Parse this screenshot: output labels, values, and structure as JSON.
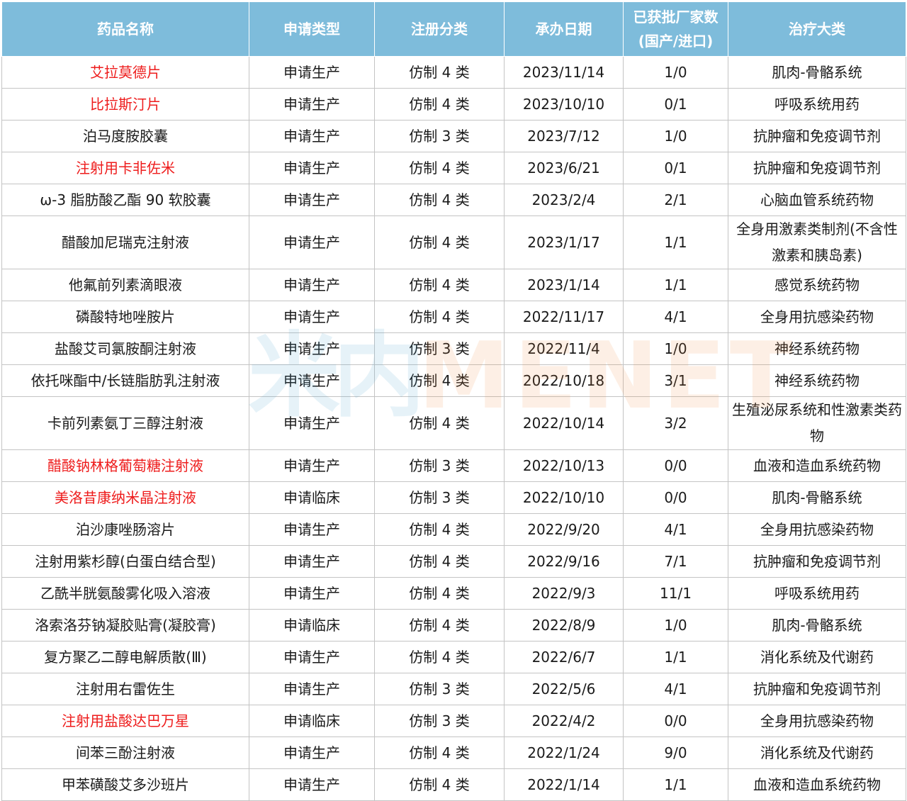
{
  "header": {
    "name": "药品名称",
    "apply_type": "申请类型",
    "reg_class": "注册分类",
    "date": "承办日期",
    "approved_line1": "已获批厂家数",
    "approved_line2": "(国产/进口)",
    "category": "治疗大类"
  },
  "rows": [
    {
      "name": "艾拉莫德片",
      "apply_type": "申请生产",
      "reg_class": "仿制 4 类",
      "date": "2023/11/14",
      "approved": "1/0",
      "category": "肌肉-骨骼系统"
    },
    {
      "name": "比拉斯汀片",
      "apply_type": "申请生产",
      "reg_class": "仿制 4 类",
      "date": "2023/10/10",
      "approved": "0/1",
      "category": "呼吸系统用药"
    },
    {
      "name": "泊马度胺胶囊",
      "apply_type": "申请生产",
      "reg_class": "仿制 3 类",
      "date": "2023/7/12",
      "approved": "1/0",
      "category": "抗肿瘤和免疫调节剂"
    },
    {
      "name": "注射用卡非佐米",
      "apply_type": "申请生产",
      "reg_class": "仿制 4 类",
      "date": "2023/6/21",
      "approved": "0/1",
      "category": "抗肿瘤和免疫调节剂"
    },
    {
      "name": "ω-3 脂肪酸乙酯 90 软胶囊",
      "apply_type": "申请生产",
      "reg_class": "仿制 4 类",
      "date": "2023/2/4",
      "approved": "2/1",
      "category": "心脑血管系统药物"
    },
    {
      "name": "醋酸加尼瑞克注射液",
      "apply_type": "申请生产",
      "reg_class": "仿制 4 类",
      "date": "2023/1/17",
      "approved": "1/1",
      "category": "全身用激素类制剂(不含性激素和胰岛素)"
    },
    {
      "name": "他氟前列素滴眼液",
      "apply_type": "申请生产",
      "reg_class": "仿制 4 类",
      "date": "2023/1/14",
      "approved": "1/1",
      "category": "感觉系统药物"
    },
    {
      "name": "磷酸特地唑胺片",
      "apply_type": "申请生产",
      "reg_class": "仿制 4 类",
      "date": "2022/11/17",
      "approved": "4/1",
      "category": "全身用抗感染药物"
    },
    {
      "name": "盐酸艾司氯胺酮注射液",
      "apply_type": "申请生产",
      "reg_class": "仿制 3 类",
      "date": "2022/11/4",
      "approved": "1/0",
      "category": "神经系统药物"
    },
    {
      "name": "依托咪酯中/长链脂肪乳注射液",
      "apply_type": "申请生产",
      "reg_class": "仿制 4 类",
      "date": "2022/10/18",
      "approved": "3/1",
      "category": "神经系统药物"
    },
    {
      "name": "卡前列素氨丁三醇注射液",
      "apply_type": "申请生产",
      "reg_class": "仿制 4 类",
      "date": "2022/10/14",
      "approved": "3/2",
      "category": "生殖泌尿系统和性激素类药物"
    },
    {
      "name": "醋酸钠林格葡萄糖注射液",
      "apply_type": "申请生产",
      "reg_class": "仿制 3 类",
      "date": "2022/10/13",
      "approved": "0/0",
      "category": "血液和造血系统药物"
    },
    {
      "name": "美洛昔康纳米晶注射液",
      "apply_type": "申请临床",
      "reg_class": "仿制 3 类",
      "date": "2022/10/10",
      "approved": "0/0",
      "category": "肌肉-骨骼系统"
    },
    {
      "name": "泊沙康唑肠溶片",
      "apply_type": "申请生产",
      "reg_class": "仿制 4 类",
      "date": "2022/9/20",
      "approved": "4/1",
      "category": "全身用抗感染药物"
    },
    {
      "name": "注射用紫杉醇(白蛋白结合型)",
      "apply_type": "申请生产",
      "reg_class": "仿制 4 类",
      "date": "2022/9/16",
      "approved": "7/1",
      "category": "抗肿瘤和免疫调节剂"
    },
    {
      "name": "乙酰半胱氨酸雾化吸入溶液",
      "apply_type": "申请生产",
      "reg_class": "仿制 4 类",
      "date": "2022/9/3",
      "approved": "11/1",
      "category": "呼吸系统用药"
    },
    {
      "name": "洛索洛芬钠凝胶贴膏(凝胶膏)",
      "apply_type": "申请临床",
      "reg_class": "仿制 4 类",
      "date": "2022/8/9",
      "approved": "1/0",
      "category": "肌肉-骨骼系统"
    },
    {
      "name": "复方聚乙二醇电解质散(Ⅲ)",
      "apply_type": "申请生产",
      "reg_class": "仿制 4 类",
      "date": "2022/6/7",
      "approved": "1/1",
      "category": "消化系统及代谢药"
    },
    {
      "name": "注射用右雷佐生",
      "apply_type": "申请生产",
      "reg_class": "仿制 3 类",
      "date": "2022/5/6",
      "approved": "4/1",
      "category": "抗肿瘤和免疫调节剂"
    },
    {
      "name": "注射用盐酸达巴万星",
      "apply_type": "申请临床",
      "reg_class": "仿制 3 类",
      "date": "2022/4/2",
      "approved": "0/0",
      "category": "全身用抗感染药物"
    },
    {
      "name": "间苯三酚注射液",
      "apply_type": "申请生产",
      "reg_class": "仿制 4 类",
      "date": "2022/1/24",
      "approved": "9/0",
      "category": "消化系统及代谢药"
    },
    {
      "name": "甲苯磺酸艾多沙班片",
      "apply_type": "申请生产",
      "reg_class": "仿制 4 类",
      "date": "2022/1/14",
      "approved": "1/1",
      "category": "血液和造血系统药物"
    }
  ],
  "watermark": {
    "text_a": "米内",
    "text_b": "MENET"
  },
  "colors": {
    "header_bg": "#7ebcdb",
    "highlight_text": "#ee1c1c",
    "watermark_blue": "#4aa4d0",
    "watermark_orange": "#f08a3c"
  }
}
